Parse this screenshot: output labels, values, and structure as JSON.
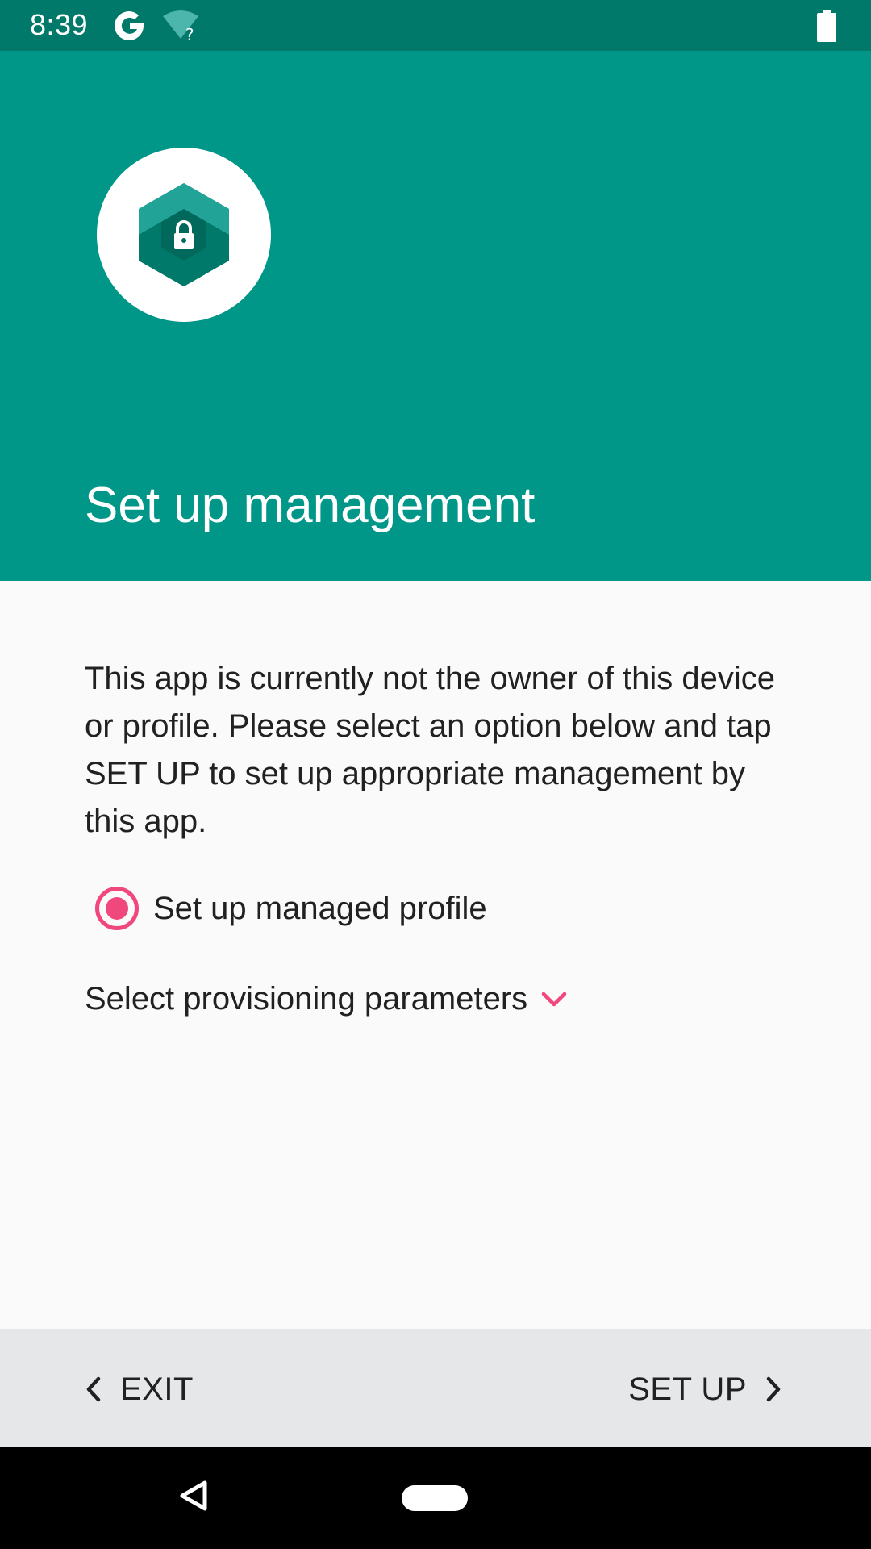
{
  "status_bar": {
    "time": "8:39",
    "icons": [
      "google-icon",
      "wifi-unknown-icon",
      "battery-icon"
    ]
  },
  "header": {
    "title": "Set up management",
    "logo_icon": "hexagon-lock-icon",
    "background_color": "#009688"
  },
  "content": {
    "description": "This app is currently not the owner of this device or profile. Please select an option below and tap SET UP to set up appropriate management by this app.",
    "option": {
      "label": "Set up managed profile",
      "selected": true
    },
    "provisioning": {
      "label": "Select provisioning parameters",
      "icon": "chevron-down-icon"
    },
    "accent_color": "#f0477c"
  },
  "footer": {
    "exit_label": "EXIT",
    "setup_label": "SET UP"
  },
  "nav_bar": {
    "icons": [
      "back-icon",
      "home-icon"
    ]
  }
}
